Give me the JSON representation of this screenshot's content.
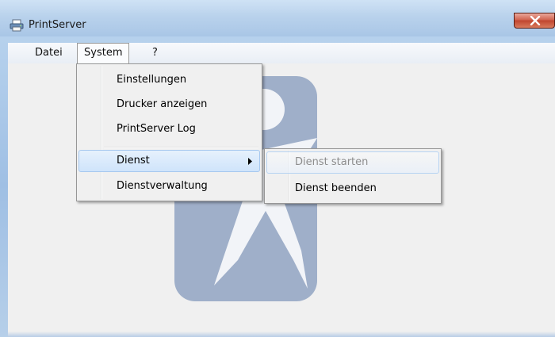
{
  "window": {
    "title": "PrintServer",
    "app_icon": "printer-icon",
    "close_icon": "close-icon"
  },
  "menubar": {
    "items": [
      {
        "label": "Datei"
      },
      {
        "label": "System"
      },
      {
        "label": "?"
      }
    ]
  },
  "system_menu": {
    "items": [
      {
        "label": "Einstellungen"
      },
      {
        "label": "Drucker anzeigen"
      },
      {
        "label": "PrintServer Log"
      },
      {
        "label": "Dienst"
      },
      {
        "label": "Dienstverwaltung"
      }
    ],
    "submenu_arrow_icon": "chevron-right-icon"
  },
  "dienst_submenu": {
    "items": [
      {
        "label": "Dienst starten",
        "enabled": false
      },
      {
        "label": "Dienst beenden",
        "enabled": true
      }
    ]
  },
  "colors": {
    "logo_tile": "#9fafc9",
    "close_button": "#c84b36",
    "highlight": "#cfe4fb"
  }
}
